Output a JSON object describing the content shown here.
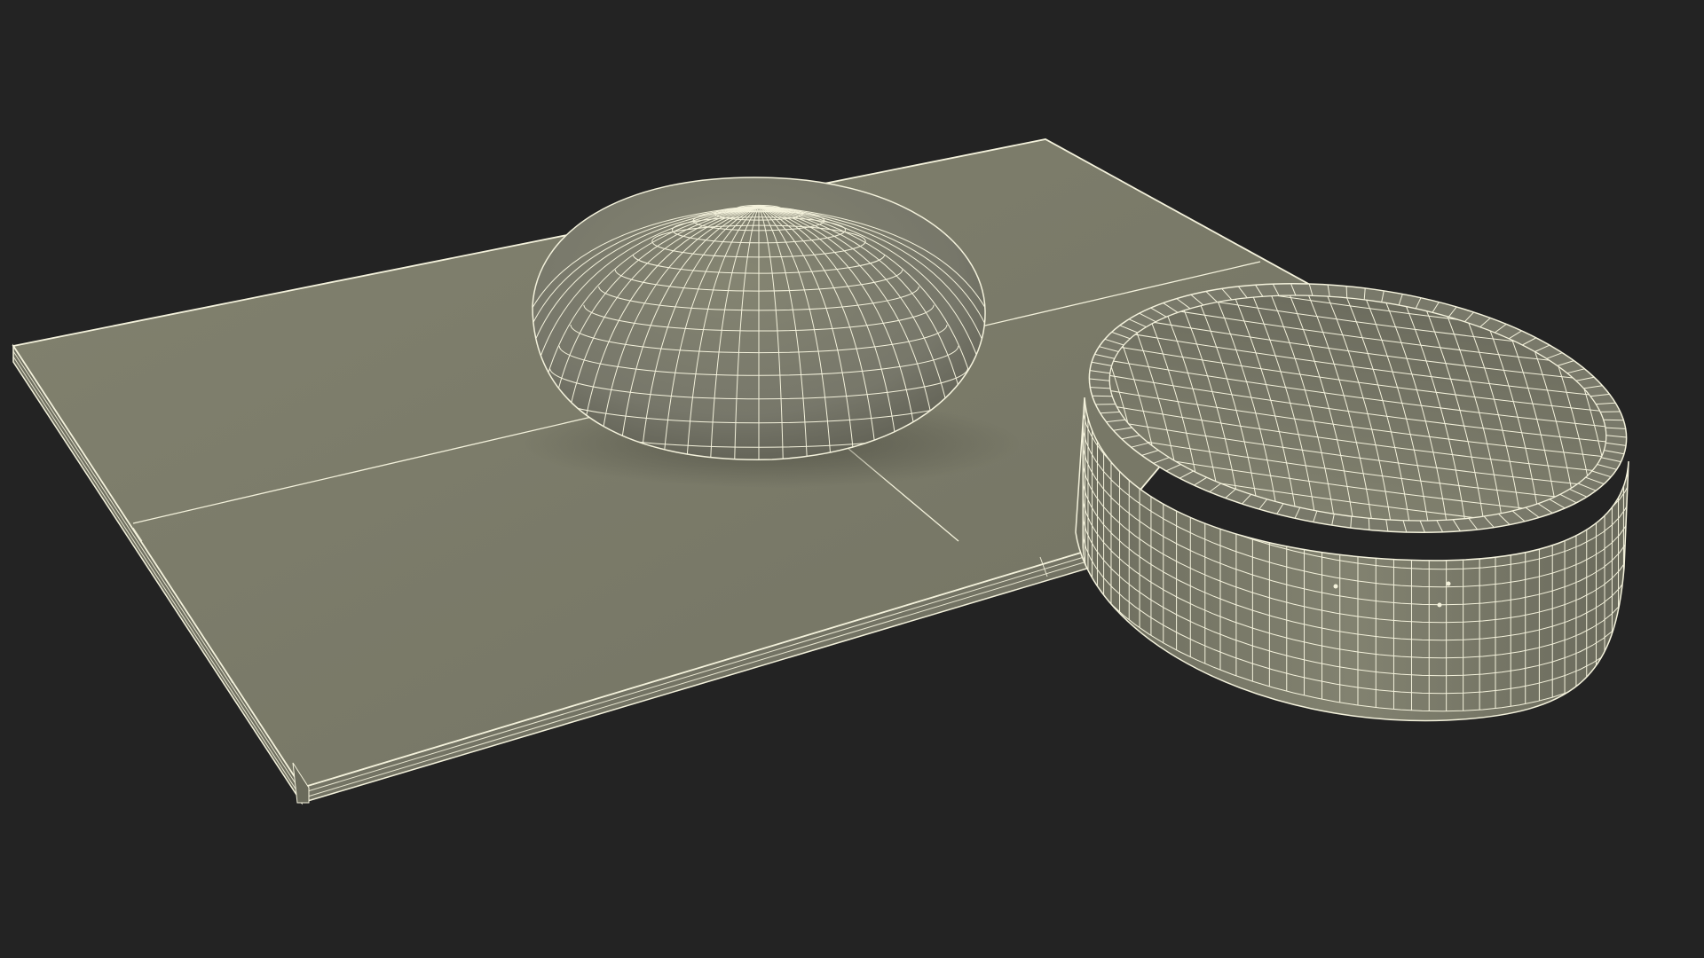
{
  "scene": {
    "background_color": "#232323",
    "surface_color": "#7a7a6a",
    "surface_shade_color": "#6e6e5f",
    "side_color": "#727264",
    "wire_color": "#f4f2dc",
    "shadow_color": "#4a4a40",
    "objects": [
      {
        "name": "cutting-board",
        "kind": "rectangular slab"
      },
      {
        "name": "dough-ball",
        "kind": "flattened sphere"
      },
      {
        "name": "proofing-basket",
        "kind": "round open container"
      }
    ]
  }
}
